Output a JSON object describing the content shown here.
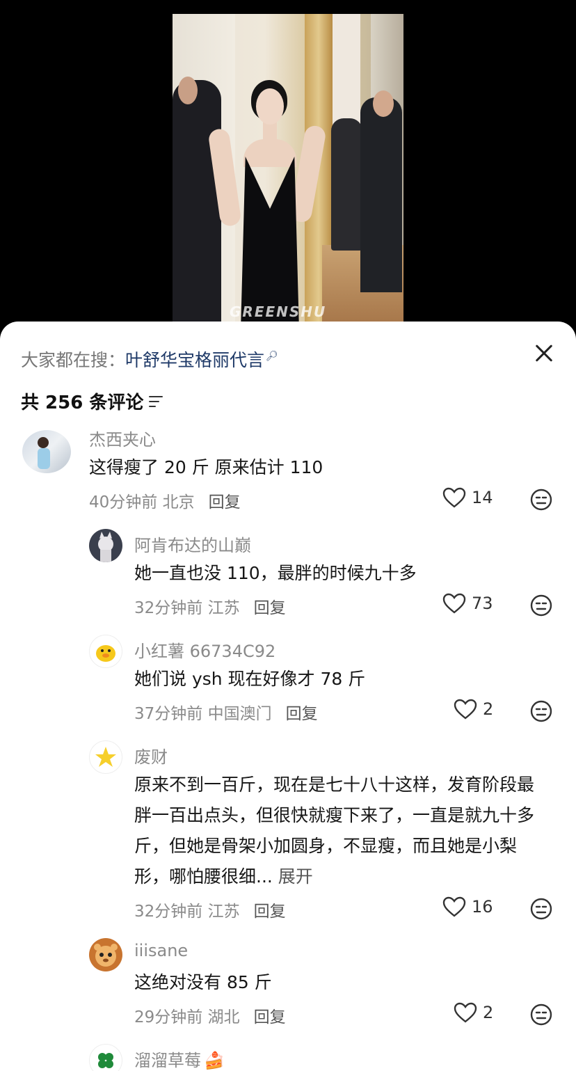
{
  "video": {
    "watermark": "GREENSHU"
  },
  "sheet": {
    "search_prefix": "大家都在搜：",
    "search_term": "叶舒华宝格丽代言",
    "comment_count_label": "共 256 条评论"
  },
  "comments": [
    {
      "author": "杰西夹心",
      "text": "这得瘦了 20 斤 原来估计 110",
      "time_location": "40分钟前 北京",
      "reply_label": "回复",
      "likes": "14"
    },
    {
      "author": "阿肯布达的山巅",
      "text": "她一直也没 110，最胖的时候九十多",
      "time_location": "32分钟前 江苏",
      "reply_label": "回复",
      "likes": "73"
    },
    {
      "author": "小红薯 66734C92",
      "text": "她们说 ysh 现在好像才 78 斤",
      "time_location": "37分钟前 中国澳门",
      "reply_label": "回复",
      "likes": "2"
    },
    {
      "author": "废财",
      "text": "原来不到一百斤，现在是七十八十这样，发育阶段最胖一百出点头，但很快就瘦下来了，一直是就九十多斤，但她是骨架小加圆身，不显瘦，而且她是小梨形，哪怕腰很细...",
      "expand_label": "展开",
      "time_location": "32分钟前 江苏",
      "reply_label": "回复",
      "likes": "16"
    },
    {
      "author": "iiisane",
      "text": "这绝对没有 85 斤",
      "time_location": "29分钟前 湖北",
      "reply_label": "回复",
      "likes": "2"
    },
    {
      "author": "溜溜草莓"
    }
  ]
}
